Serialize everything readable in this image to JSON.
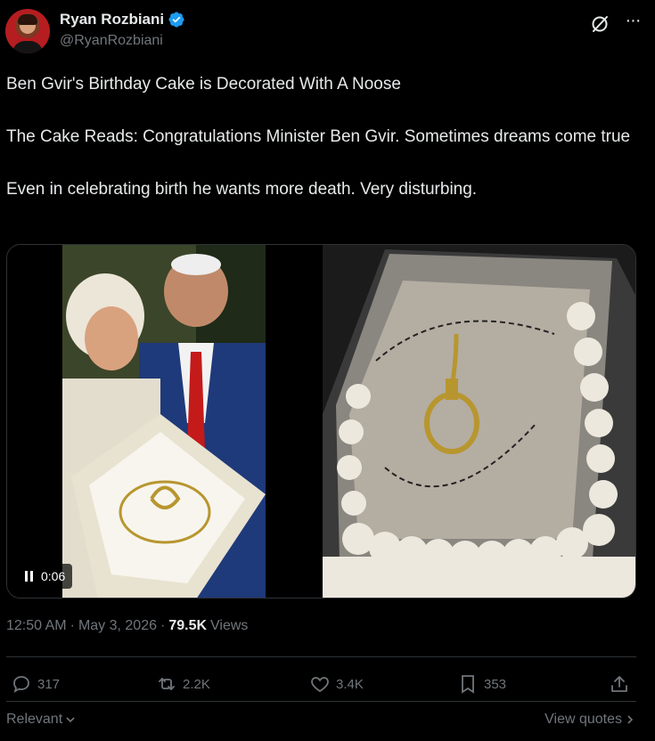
{
  "author": {
    "display_name": "Ryan Rozbiani",
    "handle": "@RyanRozbiani"
  },
  "tweet": {
    "paragraphs": [
      "Ben Gvir's Birthday Cake is Decorated With A Noose",
      "The Cake Reads: Congratulations Minister Ben Gvir. Sometimes dreams come true",
      "Even in celebrating birth he wants more death. Very disturbing."
    ]
  },
  "media": {
    "video_time": "0:06"
  },
  "meta": {
    "time": "12:50 AM",
    "separator": "·",
    "date": "May 3, 2026",
    "views_count": "79.5K",
    "views_label": "Views"
  },
  "actions": {
    "replies": "317",
    "reposts": "2.2K",
    "likes": "3.4K",
    "bookmarks": "353"
  },
  "footer": {
    "relevant_label": "Relevant",
    "view_quotes_label": "View quotes"
  },
  "colors": {
    "background": "#000000",
    "text": "#e7e9ea",
    "muted": "#71767b",
    "verified": "#1d9bf0"
  }
}
